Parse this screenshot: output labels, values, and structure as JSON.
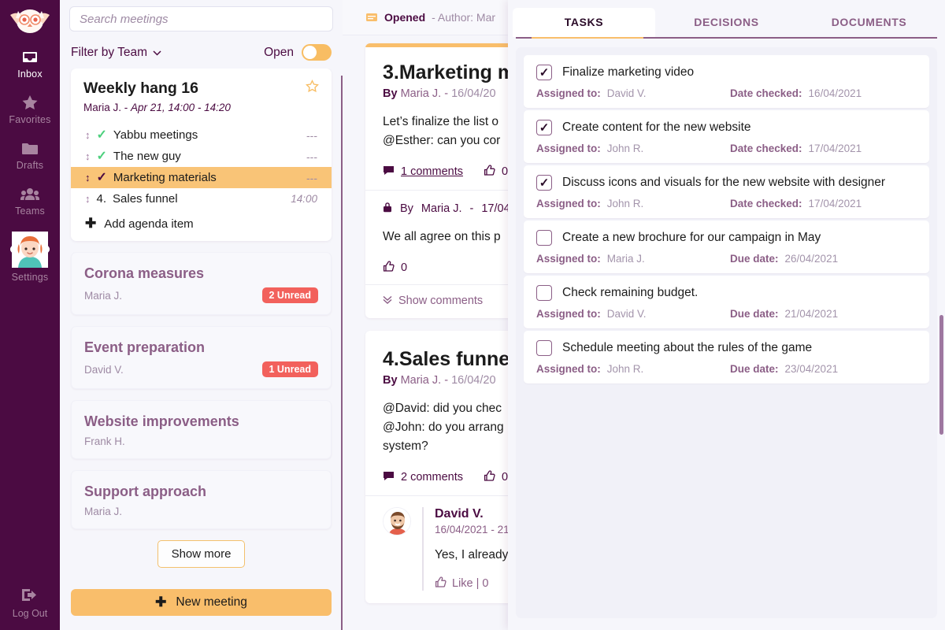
{
  "colors": {
    "rail_bg": "#4B0B42",
    "accent_orange": "#F9BE6B",
    "accent_purple": "#8B5E86",
    "badge_red": "#F2615C",
    "check_green": "#4CD07D",
    "panel_bg": "#F6F6FB"
  },
  "rail": {
    "logo_icon": "owl-logo",
    "items": [
      {
        "icon": "inbox-icon",
        "label": "Inbox",
        "active": true
      },
      {
        "icon": "star-icon",
        "label": "Favorites",
        "active": false
      },
      {
        "icon": "folder-icon",
        "label": "Drafts",
        "active": false
      },
      {
        "icon": "people-icon",
        "label": "Teams",
        "active": false
      },
      {
        "icon": "avatar-icon",
        "label": "Settings",
        "active": false
      }
    ],
    "logout": {
      "icon": "logout-icon",
      "label": "Log Out"
    }
  },
  "search": {
    "placeholder": "Search meetings",
    "value": ""
  },
  "filter": {
    "label": "Filter by Team",
    "chevron_icon": "chevron-down-icon",
    "toggle_label": "Open",
    "toggle_on": false
  },
  "selected_meeting": {
    "title": "Weekly hang 16",
    "organizer": "Maria J.",
    "separator": "-",
    "schedule": "Apr 21, 14:00 - 14:20",
    "star_icon": "star-outline-icon",
    "agenda": [
      {
        "drag_icon": "drag-handle-icon",
        "state": "done",
        "check_icon": "check-icon",
        "number": "",
        "text": "Yabbu meetings",
        "meta": "---",
        "highlight": false
      },
      {
        "drag_icon": "drag-handle-icon",
        "state": "done",
        "check_icon": "check-icon",
        "number": "",
        "text": "The new guy",
        "meta": "---",
        "highlight": false
      },
      {
        "drag_icon": "drag-handle-icon",
        "state": "current",
        "check_icon": "check-icon",
        "number": "",
        "text": "Marketing materials",
        "meta": "---",
        "highlight": true
      },
      {
        "drag_icon": "drag-handle-icon",
        "state": "pending",
        "check_icon": "",
        "number": "4.",
        "text": "Sales funnel",
        "meta": "14:00",
        "highlight": false
      }
    ],
    "add_item": {
      "icon": "plus-icon",
      "label": "Add agenda item"
    }
  },
  "meetings": [
    {
      "title": "Corona measures",
      "author": "Maria J.",
      "badge": "2 Unread"
    },
    {
      "title": "Event preparation",
      "author": "David V.",
      "badge": "1 Unread"
    },
    {
      "title": "Website improvements",
      "author": "Frank H.",
      "badge": ""
    },
    {
      "title": "Support approach",
      "author": "Maria J.",
      "badge": ""
    }
  ],
  "show_more_label": "Show more",
  "new_meeting": {
    "icon": "plus-icon",
    "label": "New meeting"
  },
  "detail": {
    "header": {
      "icon": "envelope-open-icon",
      "status": "Opened",
      "author": "- Author: Mar",
      "collapse_icon": "chevron-right-icon"
    },
    "posts": [
      {
        "title": "3.Marketing m",
        "by_prefix": "By",
        "by_author": "Maria J.",
        "by_sep": "-",
        "by_date": "16/04/20",
        "body_lines": [
          "Let’s finalize the list o",
          "@Esther: can you cor"
        ],
        "comments_icon": "comment-icon",
        "comments_label": "1 comments",
        "like_icon": "thumbs-up-icon",
        "like_count": "0",
        "locked": {
          "lock_icon": "lock-icon",
          "by_prefix": "By",
          "by_author": "Maria J.",
          "by_sep": "-",
          "by_date": "17/04/",
          "text": "We all agree on this p",
          "like_icon": "thumbs-up-icon",
          "like_count": "0"
        },
        "show_comments": {
          "icon": "chevron-double-down-icon",
          "label": "Show comments"
        }
      },
      {
        "title": "4.Sales funnel",
        "by_prefix": "By",
        "by_author": "Maria J.",
        "by_sep": "-",
        "by_date": "16/04/20",
        "body_lines": [
          "@David: did you chec",
          "@John: do you arrang",
          "system?"
        ],
        "comments_icon": "comment-icon",
        "comments_label": "2 comments",
        "like_icon": "thumbs-up-icon",
        "like_count": "0",
        "comment": {
          "avatar_icon": "user-avatar-icon",
          "name": "David V.",
          "date": "16/04/2021 - 21:",
          "text": "Yes, I already",
          "like_icon": "thumbs-up-icon",
          "like_label": "Like | 0"
        }
      }
    ]
  },
  "tasks_panel": {
    "tabs": [
      {
        "label": "TASKS",
        "active": true
      },
      {
        "label": "DECISIONS",
        "active": false
      },
      {
        "label": "DOCUMENTS",
        "active": false
      }
    ],
    "tasks": [
      {
        "checked": true,
        "check_icon": "check-icon",
        "title": "Finalize marketing video",
        "assigned_label": "Assigned to:",
        "assignee": "David V.",
        "date_label": "Date checked:",
        "date": "16/04/2021"
      },
      {
        "checked": true,
        "check_icon": "check-icon",
        "title": "Create content for the new website",
        "assigned_label": "Assigned to:",
        "assignee": "John R.",
        "date_label": "Date checked:",
        "date": "17/04/2021"
      },
      {
        "checked": true,
        "check_icon": "check-icon",
        "title": "Discuss icons and visuals for the new website with designer",
        "assigned_label": "Assigned to:",
        "assignee": "John R.",
        "date_label": "Date checked:",
        "date": "17/04/2021"
      },
      {
        "checked": false,
        "check_icon": "",
        "title": "Create a new brochure for our campaign in May",
        "assigned_label": "Assigned to:",
        "assignee": "Maria J.",
        "date_label": "Due date:",
        "date": "26/04/2021"
      },
      {
        "checked": false,
        "check_icon": "",
        "title": "Check remaining budget.",
        "assigned_label": "Assigned to:",
        "assignee": "David V.",
        "date_label": "Due date:",
        "date": "21/04/2021"
      },
      {
        "checked": false,
        "check_icon": "",
        "title": "Schedule meeting about the rules of the game",
        "assigned_label": "Assigned to:",
        "assignee": "John R.",
        "date_label": "Due date:",
        "date": "23/04/2021"
      }
    ]
  }
}
